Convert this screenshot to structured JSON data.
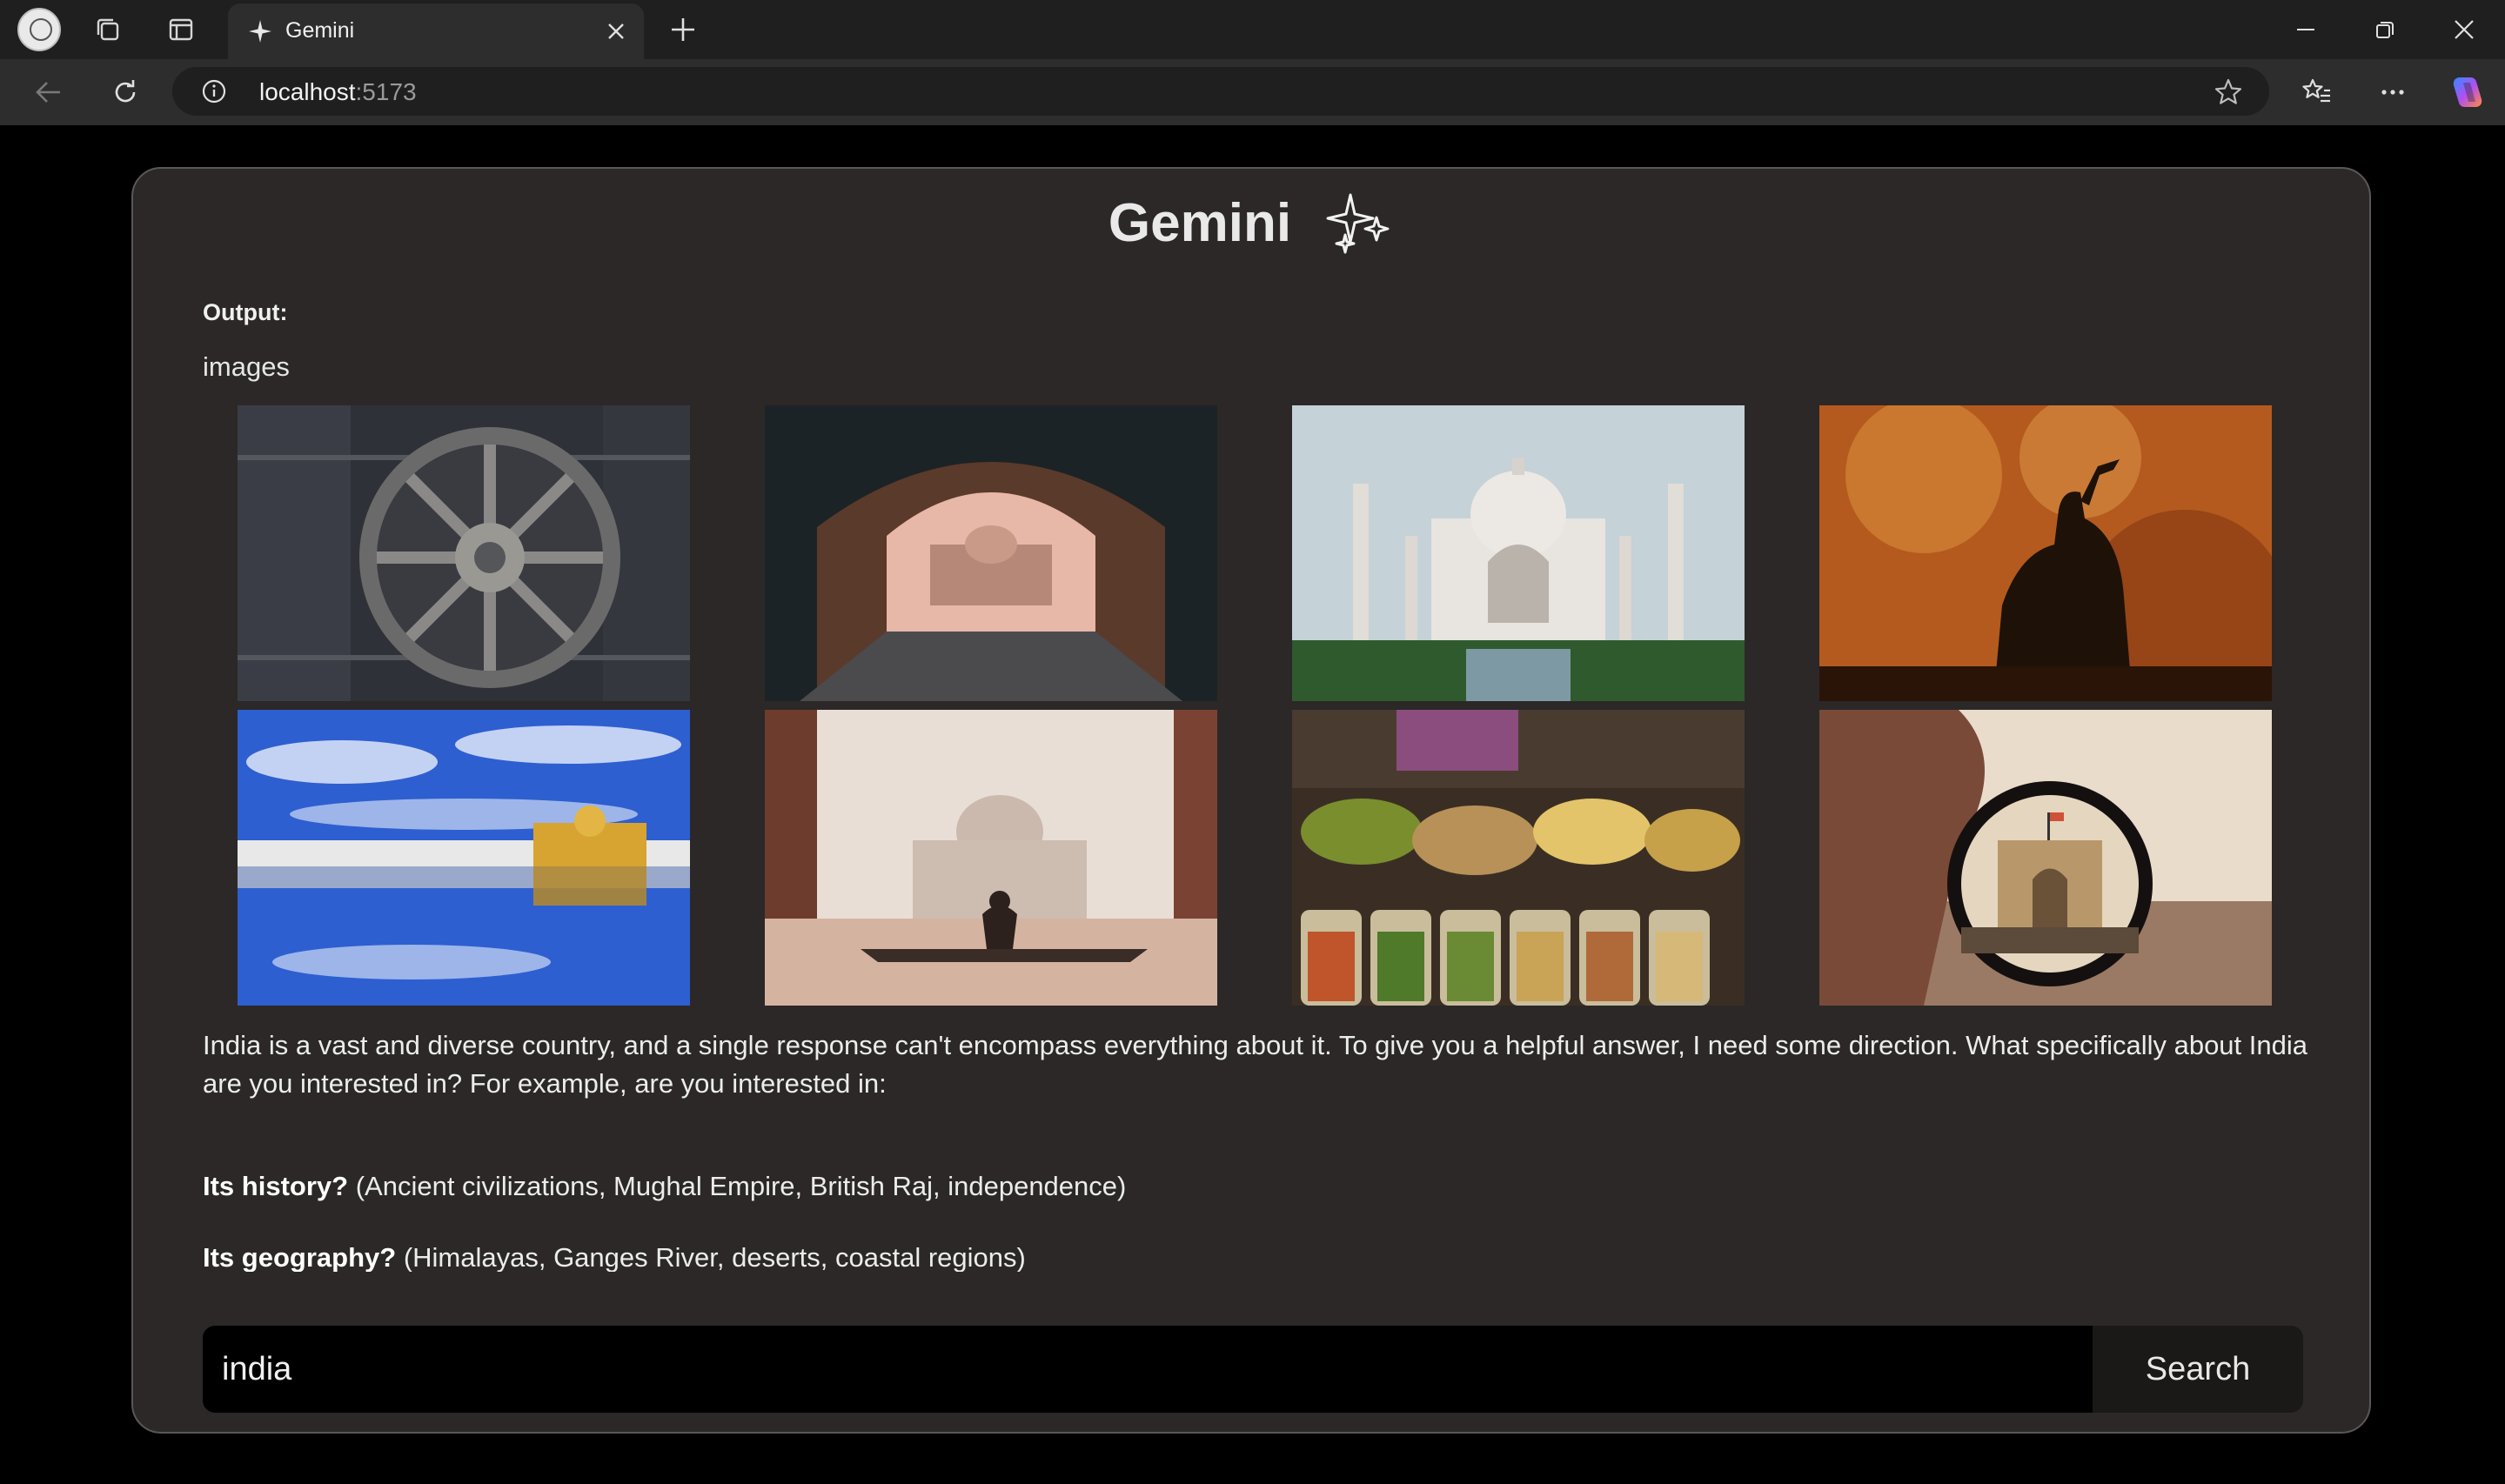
{
  "browser": {
    "tab_title": "Gemini",
    "address_host": "localhost",
    "address_port": ":5173"
  },
  "app": {
    "title": "Gemini",
    "output_label": "Output:",
    "images_label": "images",
    "images": [
      {
        "subject": "sun temple chariot wheel"
      },
      {
        "subject": "archway framing a mughal monument"
      },
      {
        "subject": "taj mahal with gardens"
      },
      {
        "subject": "silhouette in festival smoke"
      },
      {
        "subject": "golden temple reflection"
      },
      {
        "subject": "person seated before taj mahal"
      },
      {
        "subject": "spice and grain market"
      },
      {
        "subject": "gateway of india through a lens"
      }
    ],
    "response_intro": "India is a vast and diverse country, and a single response can't encompass everything about it.  To give you a helpful answer, I need some direction. What specifically about India are you interested in?  For example, are you interested in:",
    "items": [
      {
        "bold": "Its history?",
        "text": " (Ancient civilizations, Mughal Empire, British Raj, independence)"
      },
      {
        "bold": "Its geography?",
        "text": " (Himalayas, Ganges River, deserts, coastal regions)"
      }
    ],
    "search": {
      "value": "india",
      "button_label": "Search"
    }
  }
}
